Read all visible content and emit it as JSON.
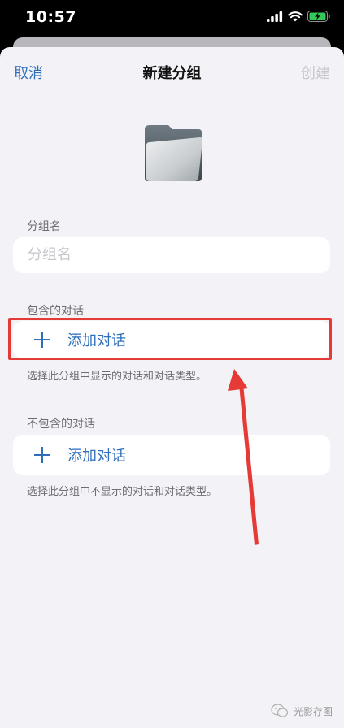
{
  "status_bar": {
    "time": "10:57"
  },
  "nav": {
    "cancel": "取消",
    "title": "新建分组",
    "create": "创建"
  },
  "group_name": {
    "label": "分组名",
    "placeholder": "分组名"
  },
  "included": {
    "label": "包含的对话",
    "add_label": "添加对话",
    "footnote": "选择此分组中显示的对话和对话类型。"
  },
  "excluded": {
    "label": "不包含的对话",
    "add_label": "添加对话",
    "footnote": "选择此分组中不显示的对话和对话类型。"
  },
  "watermark": "光影存图",
  "colors": {
    "accent": "#2f6fba",
    "annotation": "#e53a36"
  }
}
